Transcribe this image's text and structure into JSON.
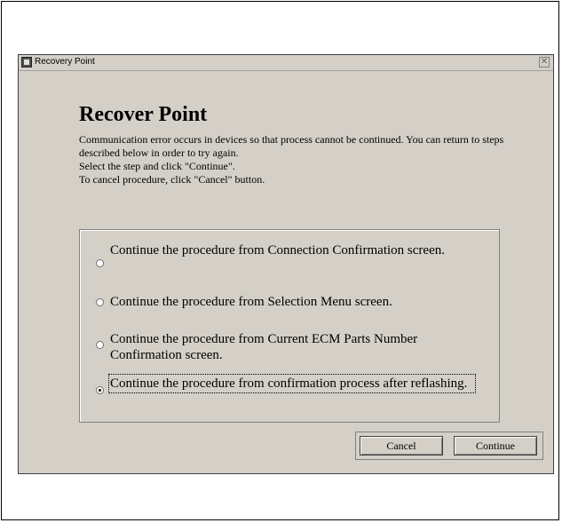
{
  "window": {
    "title": "Recovery Point",
    "close_glyph": "✕"
  },
  "main": {
    "heading": "Recover Point",
    "description": [
      "Communication error occurs in devices so that process cannot be continued. You can return to steps described below in order to try again.",
      "Select the step and click \"Continue\".",
      "To cancel procedure, click \"Cancel\" button."
    ],
    "options": [
      {
        "label": "Continue the procedure from Connection Confirmation screen.",
        "selected": false
      },
      {
        "label": "Continue the procedure from Selection Menu screen.",
        "selected": false
      },
      {
        "label": "Continue the procedure from Current ECM Parts Number Confirmation screen.",
        "selected": false
      },
      {
        "label": "Continue the procedure from confirmation process after reflashing.",
        "selected": true
      }
    ]
  },
  "buttons": {
    "cancel": "Cancel",
    "continue": "Continue"
  }
}
